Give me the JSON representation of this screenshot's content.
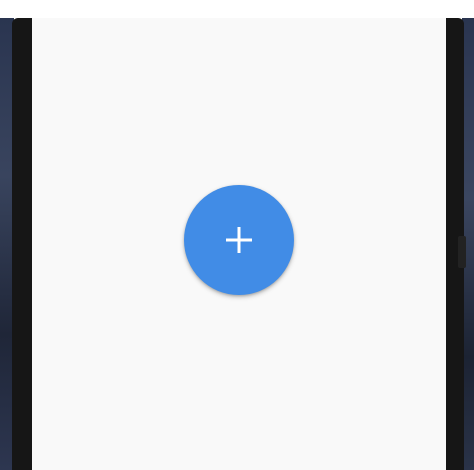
{
  "fab": {
    "icon": "plus-icon",
    "color": "#418ce6",
    "icon_color": "#ffffff"
  },
  "screen": {
    "background": "#f9f9f9"
  }
}
